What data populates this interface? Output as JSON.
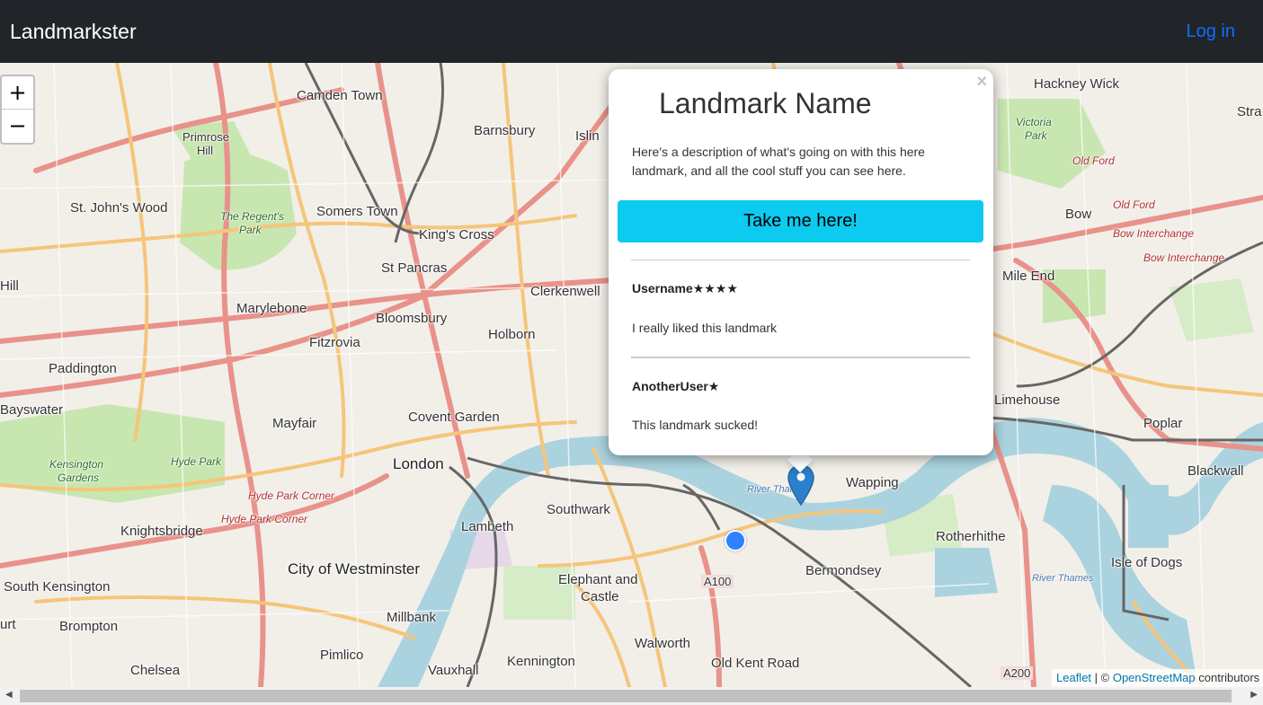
{
  "navbar": {
    "brand": "Landmarkster",
    "login": "Log in"
  },
  "map": {
    "zoom_in": "+",
    "zoom_out": "−",
    "labels": {
      "camden_town": "Camden Town",
      "hackney_wick": "Hackney Wick",
      "barnsbury": "Barnsbury",
      "islington": "Islin",
      "primrose_hill": "Primrose",
      "primrose_hill2": "Hill",
      "st_johns_wood": "St. John's Wood",
      "somers_town": "Somers Town",
      "kings_cross": "King's Cross",
      "the_regents_park": "The Regent's",
      "the_regents_park2": "Park",
      "st_pancras": "St Pancras",
      "clerkenwell": "Clerkenwell",
      "marylebone": "Marylebone",
      "bloomsbury": "Bloomsbury",
      "fitzrovia": "Fitzrovia",
      "holborn": "Holborn",
      "paddington": "Paddington",
      "bayswater": "Bayswater",
      "mayfair": "Mayfair",
      "covent_garden": "Covent Garden",
      "london": "London",
      "kensington_gardens": "Kensington",
      "kensington_gardens2": "Gardens",
      "hyde_park": "Hyde Park",
      "hyde_park_corner": "Hyde Park Corner",
      "knightsbridge": "Knightsbridge",
      "lambeth": "Lambeth",
      "southwark": "Southwark",
      "city_of_westminster": "City of Westminster",
      "south_kensington": "South Kensington",
      "elephant_and_castle": "Elephant and",
      "elephant_and_castle2": "Castle",
      "millbank": "Millbank",
      "brompton": "Brompton",
      "pimlico": "Pimlico",
      "walworth": "Walworth",
      "chelsea": "Chelsea",
      "vauxhall": "Vauxhall",
      "kennington": "Kennington",
      "old_kent_road": "Old Kent Road",
      "bermondsey": "Bermondsey",
      "rotherhithe": "Rotherhithe",
      "wapping": "Wapping",
      "isle_of_dogs": "Isle of Dogs",
      "blackwall": "Blackwall",
      "poplar": "Poplar",
      "limehouse": "Limehouse",
      "mile_end": "Mile End",
      "bow": "Bow",
      "victoria_park": "Victoria",
      "victoria_park2": "Park",
      "old_ford": "Old Ford",
      "old_ford2": "Old Ford",
      "bow_interchange": "Bow Interchange",
      "bow_interchange2": "Bow Interchange",
      "river_thames": "River Thames",
      "a100": "A100",
      "a200": "A200",
      "hill": "Hill",
      "urt": "urt",
      "strat": "Stra"
    },
    "attribution": {
      "leaflet": "Leaflet",
      "sep": " | © ",
      "osm": "OpenStreetMap",
      "suffix": " contributors"
    }
  },
  "popup": {
    "close": "×",
    "title": "Landmark Name",
    "description": "Here's a description of what's going on with this here landmark, and all the cool stuff you can see here.",
    "button": "Take me here!",
    "reviews": [
      {
        "user": "Username★★★★",
        "text": "I really liked this landmark"
      },
      {
        "user": "AnotherUser★",
        "text": "This landmark sucked!"
      }
    ]
  },
  "scrollbar": {
    "left_arrow": "◀",
    "right_arrow": "▶"
  },
  "colors": {
    "navbar": "#212529",
    "login": "#0d6efd",
    "button": "#0dcaf0",
    "marker": "#2a81cb"
  }
}
